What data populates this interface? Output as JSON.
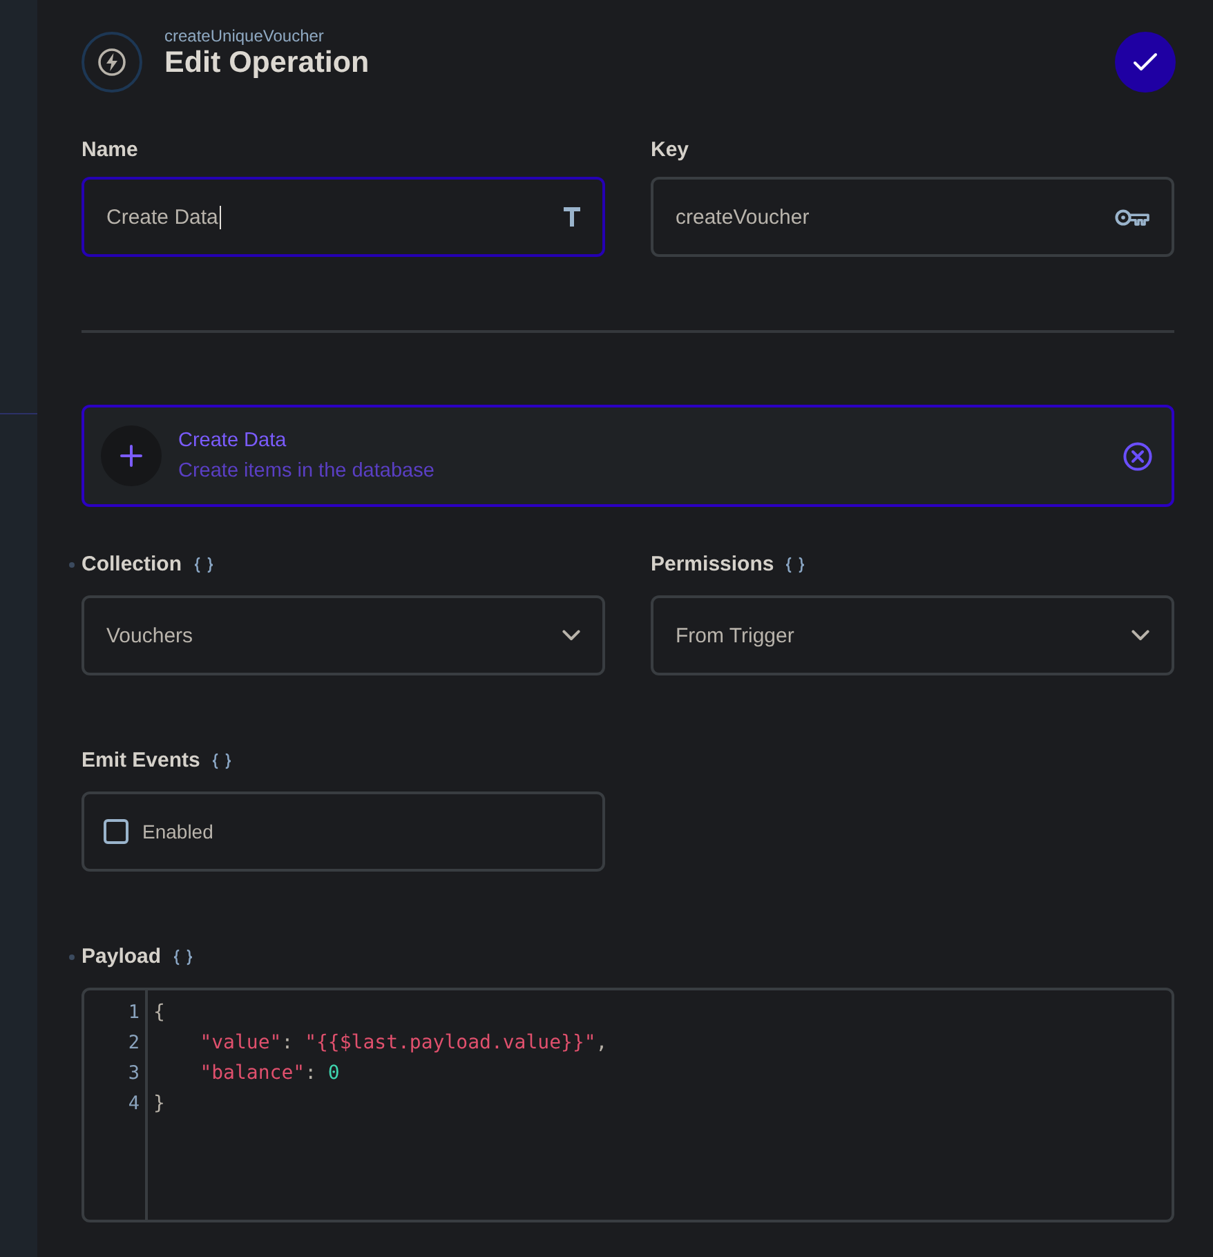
{
  "header": {
    "subtitle": "createUniqueVoucher",
    "title": "Edit Operation"
  },
  "fields": [
    {
      "label": "Name",
      "value": "Create Data",
      "focused": true
    },
    {
      "label": "Key",
      "value": "createVoucher",
      "focused": false
    }
  ],
  "operation": {
    "title": "Create Data",
    "description": "Create items in the database",
    "selected": true
  },
  "options": [
    {
      "kind": "select",
      "label": "Collection",
      "edited": true,
      "value": "Vouchers"
    },
    {
      "kind": "select",
      "label": "Permissions",
      "edited": false,
      "value": "From Trigger"
    },
    {
      "kind": "checkbox",
      "label": "Emit Events",
      "edited": false,
      "option": "Enabled",
      "checked": false
    }
  ],
  "payload": {
    "label": "Payload",
    "edited": true,
    "lines": [
      {
        "number": "1",
        "indented": false,
        "tokens": [
          {
            "kind": "punct",
            "text": "{"
          }
        ]
      },
      {
        "number": "2",
        "indented": true,
        "tokens": [
          {
            "kind": "key",
            "text": "\"value\""
          },
          {
            "kind": "punct",
            "text": ": "
          },
          {
            "kind": "string",
            "text": "\"{{$last.payload.value}}\""
          },
          {
            "kind": "punct",
            "text": ","
          }
        ]
      },
      {
        "number": "3",
        "indented": true,
        "tokens": [
          {
            "kind": "key",
            "text": "\"balance\""
          },
          {
            "kind": "punct",
            "text": ": "
          },
          {
            "kind": "number",
            "text": "0"
          }
        ]
      },
      {
        "number": "4",
        "indented": false,
        "tokens": [
          {
            "kind": "punct",
            "text": "}"
          }
        ]
      }
    ]
  }
}
